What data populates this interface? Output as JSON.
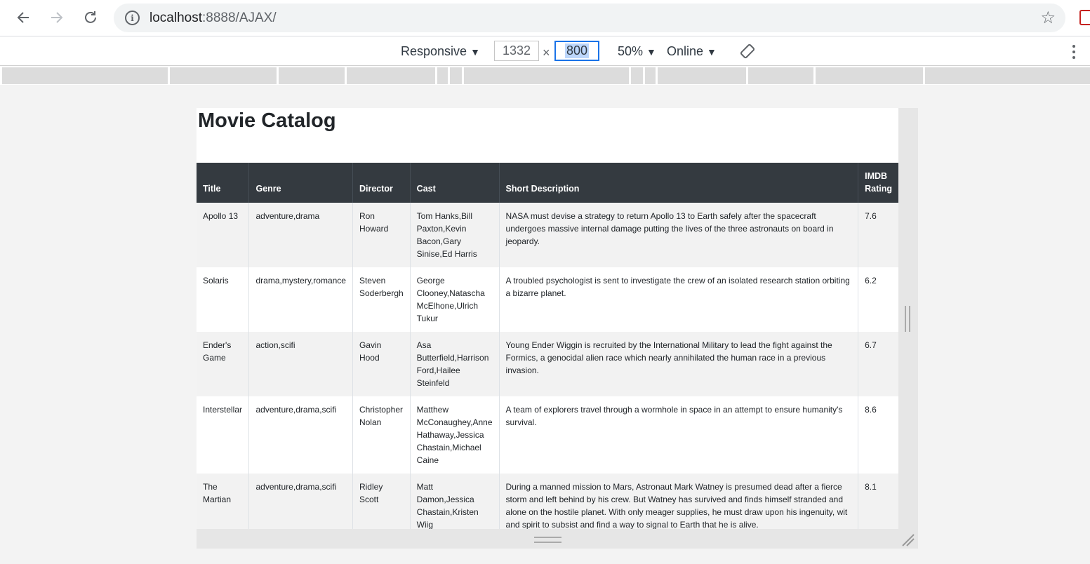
{
  "browser": {
    "url_host": "localhost",
    "url_rest": ":8888/AJAX/"
  },
  "device_toolbar": {
    "mode": "Responsive",
    "width": "1332",
    "times": "×",
    "height": "800",
    "zoom": "50%",
    "throttling": "Online"
  },
  "page": {
    "title": "Movie Catalog",
    "columns": [
      "Title",
      "Genre",
      "Director",
      "Cast",
      "Short Description",
      "IMDB Rating"
    ],
    "movies": [
      {
        "title": "Apollo 13",
        "genre": "adventure,drama",
        "director": "Ron Howard",
        "cast": "Tom Hanks,Bill Paxton,Kevin Bacon,Gary Sinise,Ed Harris",
        "description": "NASA must devise a strategy to return Apollo 13 to Earth safely after the spacecraft undergoes massive internal damage putting the lives of the three astronauts on board in jeopardy.",
        "rating": "7.6"
      },
      {
        "title": "Solaris",
        "genre": "drama,mystery,romance",
        "director": "Steven Soderbergh",
        "cast": "George Clooney,Natascha McElhone,Ulrich Tukur",
        "description": "A troubled psychologist is sent to investigate the crew of an isolated research station orbiting a bizarre planet.",
        "rating": "6.2"
      },
      {
        "title": "Ender's Game",
        "genre": "action,scifi",
        "director": "Gavin Hood",
        "cast": "Asa Butterfield,Harrison Ford,Hailee Steinfeld",
        "description": "Young Ender Wiggin is recruited by the International Military to lead the fight against the Formics, a genocidal alien race which nearly annihilated the human race in a previous invasion.",
        "rating": "6.7"
      },
      {
        "title": "Interstellar",
        "genre": "adventure,drama,scifi",
        "director": "Christopher Nolan",
        "cast": "Matthew McConaughey,Anne Hathaway,Jessica Chastain,Michael Caine",
        "description": "A team of explorers travel through a wormhole in space in an attempt to ensure humanity's survival.",
        "rating": "8.6"
      },
      {
        "title": "The Martian",
        "genre": "adventure,drama,scifi",
        "director": "Ridley Scott",
        "cast": "Matt Damon,Jessica Chastain,Kristen Wiig",
        "description": "During a manned mission to Mars, Astronaut Mark Watney is presumed dead after a fierce storm and left behind by his crew. But Watney has survived and finds himself stranded and alone on the hostile planet. With only meager supplies, he must draw upon his ingenuity, wit and spirit to subsist and find a way to signal to Earth that he is alive.",
        "rating": "8.1"
      }
    ]
  }
}
